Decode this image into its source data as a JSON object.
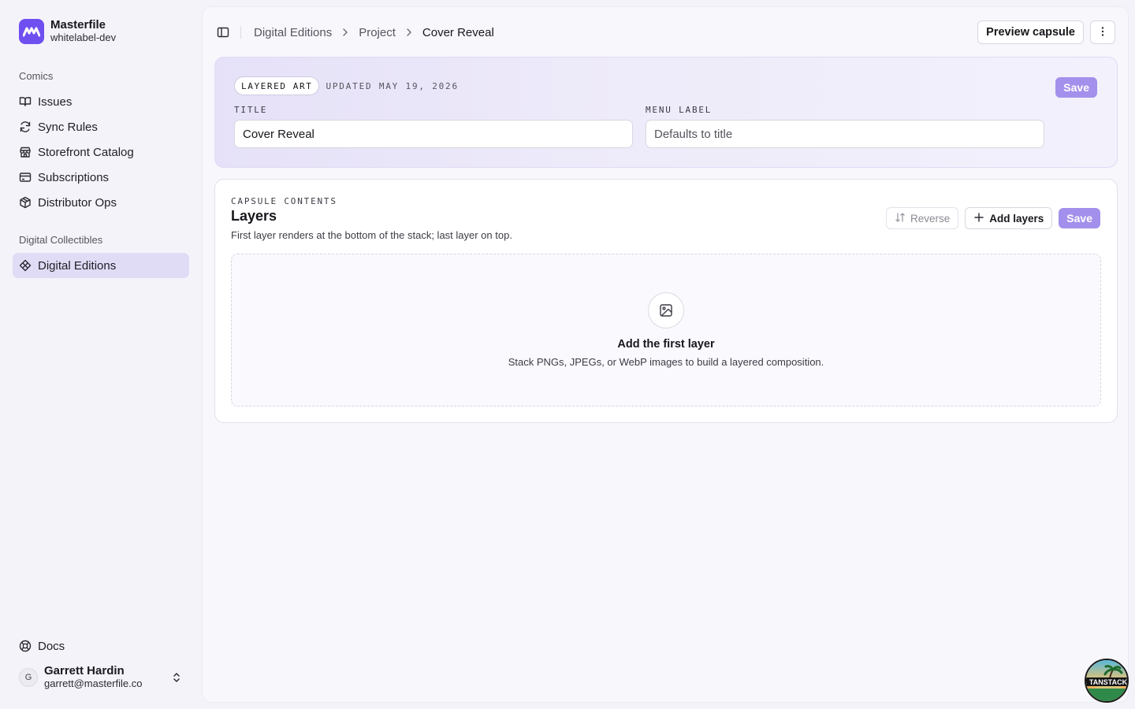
{
  "brand": {
    "name": "Masterfile",
    "workspace": "whitelabel-dev"
  },
  "sidebar": {
    "groups": [
      {
        "label": "Comics",
        "items": [
          {
            "label": "Issues",
            "icon": "book-open-icon"
          },
          {
            "label": "Sync Rules",
            "icon": "refresh-icon"
          },
          {
            "label": "Storefront Catalog",
            "icon": "storefront-icon"
          },
          {
            "label": "Subscriptions",
            "icon": "credit-card-icon"
          },
          {
            "label": "Distributor Ops",
            "icon": "package-icon"
          }
        ]
      },
      {
        "label": "Digital Collectibles",
        "items": [
          {
            "label": "Digital Editions",
            "icon": "diamond-icon",
            "active": true
          }
        ]
      }
    ],
    "docs_label": "Docs",
    "user": {
      "initial": "G",
      "name": "Garrett Hardin",
      "email": "garrett@masterfile.co"
    }
  },
  "topbar": {
    "breadcrumb": [
      "Digital Editions",
      "Project",
      "Cover Reveal"
    ],
    "preview_label": "Preview capsule"
  },
  "header": {
    "badge": "LAYERED ART",
    "updated": "UPDATED MAY 19, 2026",
    "save_label": "Save",
    "title_label": "TITLE",
    "title_value": "Cover Reveal",
    "menu_label": "MENU LABEL",
    "menu_placeholder": "Defaults to title"
  },
  "layers": {
    "eyebrow": "CAPSULE CONTENTS",
    "title": "Layers",
    "description": "First layer renders at the bottom of the stack; last layer on top.",
    "reverse_label": "Reverse",
    "add_label": "Add layers",
    "save_label": "Save",
    "empty_title": "Add the first layer",
    "empty_subtitle": "Stack PNGs, JPEGs, or WebP images to build a layered composition."
  },
  "devtools": {
    "label": "TANSTACK"
  },
  "colors": {
    "accent": "#6f4ff0",
    "primary_button": "#a390ec",
    "active_nav": "#e0dcf6"
  }
}
